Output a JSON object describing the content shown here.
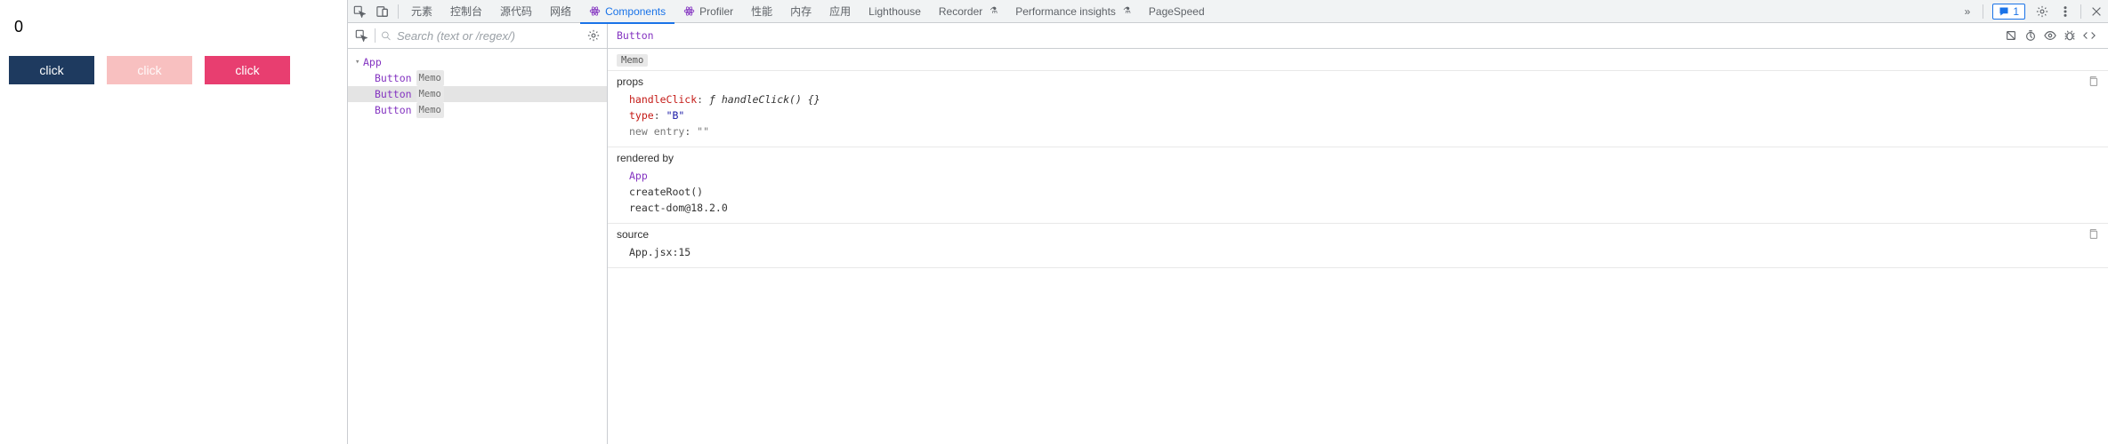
{
  "page": {
    "counter": "0",
    "buttons": [
      "click",
      "click",
      "click"
    ]
  },
  "devtools": {
    "tabs": {
      "elements": "元素",
      "console": "控制台",
      "sources": "源代码",
      "network": "网络",
      "components": "Components",
      "profiler": "Profiler",
      "performance": "性能",
      "memory": "内存",
      "application": "应用",
      "lighthouse": "Lighthouse",
      "recorder": "Recorder",
      "perf_insights": "Performance insights",
      "pagespeed": "PageSpeed"
    },
    "more_tabs_glyph": "»",
    "messages_count": "1"
  },
  "tree": {
    "search_placeholder": "Search (text or /regex/)",
    "root": "App",
    "children": [
      {
        "name": "Button",
        "hoc": "Memo"
      },
      {
        "name": "Button",
        "hoc": "Memo"
      },
      {
        "name": "Button",
        "hoc": "Memo"
      }
    ]
  },
  "detail": {
    "selected": "Button",
    "hoc": "Memo",
    "props_label": "props",
    "props": {
      "handleClick": {
        "key": "handleClick",
        "value": "ƒ handleClick() {}"
      },
      "type": {
        "key": "type",
        "value": "\"B\""
      },
      "new_entry": {
        "key": "new entry",
        "value": "\"\""
      }
    },
    "rendered_label": "rendered by",
    "rendered": {
      "app": "App",
      "createRoot": "createRoot()",
      "reactdom": "react-dom@18.2.0"
    },
    "source_label": "source",
    "source": "App.jsx:15"
  }
}
